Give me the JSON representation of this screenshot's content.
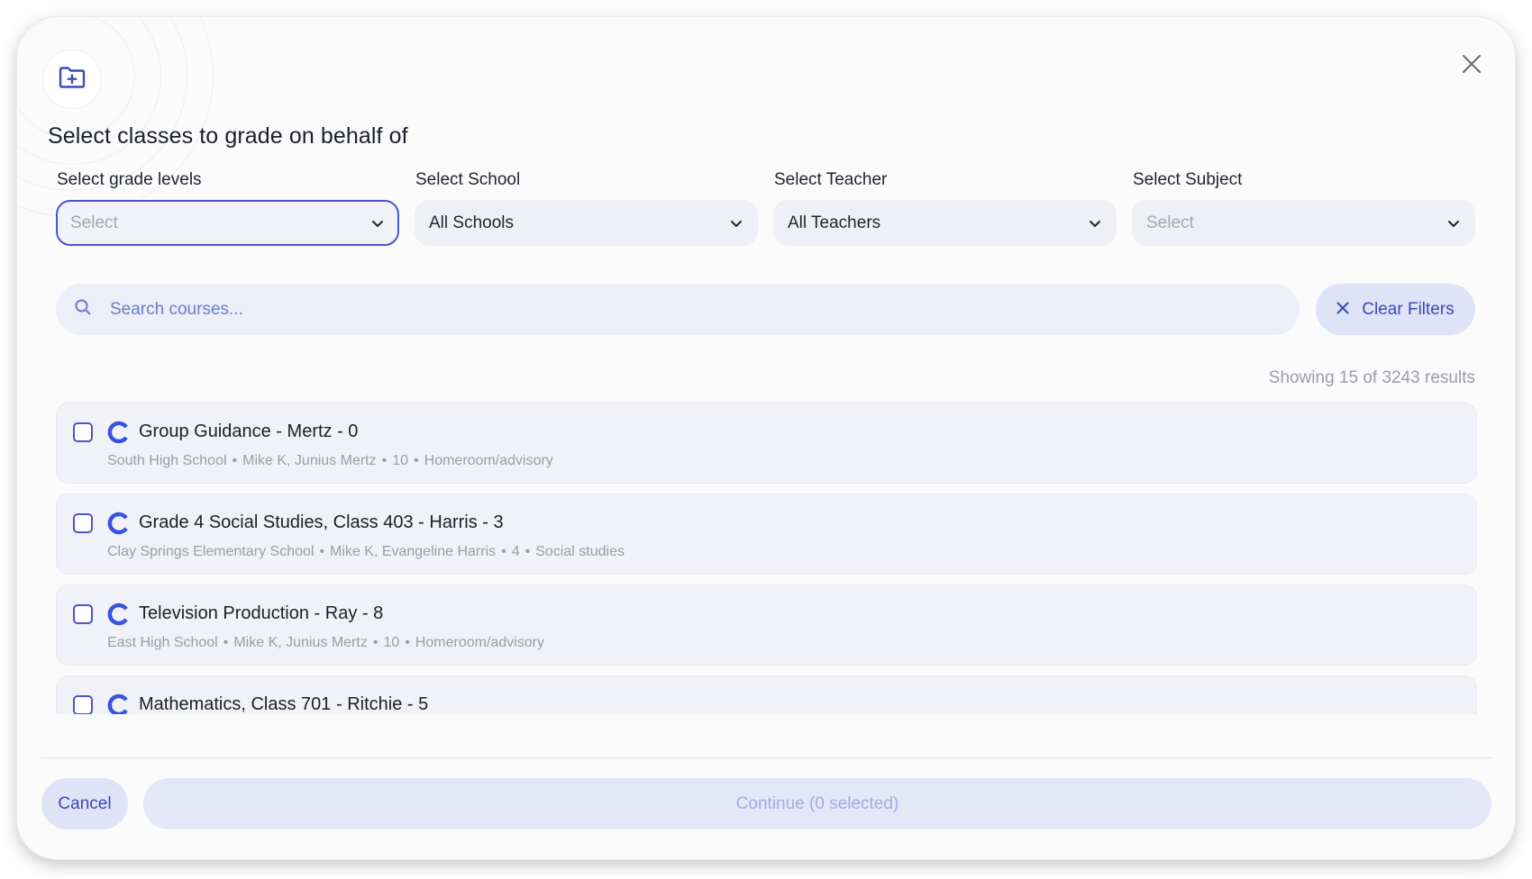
{
  "dialog": {
    "title": "Select classes to grade on behalf of",
    "header_icon": "folder-plus-icon",
    "close_icon": "close-icon"
  },
  "filters": [
    {
      "label": "Select grade levels",
      "value": "Select",
      "is_placeholder": true,
      "focused": true
    },
    {
      "label": "Select School",
      "value": "All Schools",
      "is_placeholder": false,
      "focused": false
    },
    {
      "label": "Select Teacher",
      "value": "All Teachers",
      "is_placeholder": false,
      "focused": false
    },
    {
      "label": "Select Subject",
      "value": "Select",
      "is_placeholder": true,
      "focused": false
    }
  ],
  "search": {
    "placeholder": "Search courses...",
    "value": "",
    "icon": "search-icon"
  },
  "clear_filters": {
    "label": "Clear Filters",
    "icon": "close-icon"
  },
  "results": {
    "text": "Showing 15 of 3243 results"
  },
  "courses": [
    {
      "name": "Group Guidance - Mertz - 0",
      "school": "South High School",
      "teachers": "Mike K, Junius Mertz",
      "grade": "10",
      "subject": "Homeroom/advisory",
      "checked": false
    },
    {
      "name": "Grade 4 Social Studies, Class 403 - Harris - 3",
      "school": "Clay Springs Elementary School",
      "teachers": "Mike K, Evangeline Harris",
      "grade": "4",
      "subject": "Social studies",
      "checked": false
    },
    {
      "name": "Television Production - Ray - 8",
      "school": "East High School",
      "teachers": "Mike K, Junius Mertz",
      "grade": "10",
      "subject": "Homeroom/advisory",
      "checked": false
    },
    {
      "name": "Mathematics, Class 701 - Ritchie - 5",
      "school": "",
      "teachers": "",
      "grade": "",
      "subject": "",
      "checked": false
    }
  ],
  "footer": {
    "cancel_label": "Cancel",
    "continue_label": "Continue (0 selected)"
  },
  "colors": {
    "accent": "#4a55c9",
    "accent_text": "#3c48b8",
    "soft_accent_bg": "#dfe3f7",
    "muted_text": "#9a9da8"
  }
}
